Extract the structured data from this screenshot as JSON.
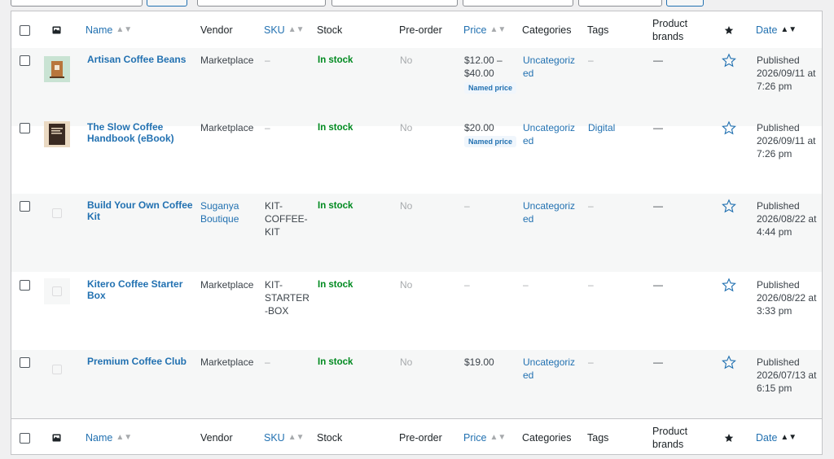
{
  "columns": {
    "name": "Name",
    "vendor": "Vendor",
    "sku": "SKU",
    "stock": "Stock",
    "preorder": "Pre-order",
    "price": "Price",
    "categories": "Categories",
    "tags": "Tags",
    "product_brands_line1": "Product",
    "product_brands_line2": "brands",
    "date": "Date"
  },
  "icons": {
    "sort": "sort-icon",
    "image": "image-icon",
    "featured": "star-icon"
  },
  "colors": {
    "link": "#2271b1",
    "in_stock": "#008a20",
    "muted": "#a7aaad",
    "alt_row": "#f6f7f7"
  },
  "rows": [
    {
      "name_line1": "Artisan Coffee Beans",
      "name_line2": "",
      "vendor_line1": "Marketplace",
      "vendor_line2": "",
      "sku_line1": "–",
      "sku_line2": "",
      "sku_line3": "",
      "stock": "In stock",
      "preorder": "No",
      "price_line1": "$12.00 –",
      "price_line2": "$40.00",
      "price_badge": "Named price",
      "cat_line1": "Uncategoriz",
      "cat_line2": "ed",
      "tags": "–",
      "brands": "—",
      "date_line1": "Published",
      "date_line2": "2026/09/11 at",
      "date_line3": "7:26 pm"
    },
    {
      "name_line1": "The Slow Coffee",
      "name_line2": "Handbook (eBook)",
      "vendor_line1": "Marketplace",
      "vendor_line2": "",
      "sku_line1": "–",
      "sku_line2": "",
      "sku_line3": "",
      "stock": "In stock",
      "preorder": "No",
      "price_line1": "$20.00",
      "price_line2": "",
      "price_badge": "Named price",
      "cat_line1": "Uncategoriz",
      "cat_line2": "ed",
      "tags": "Digital",
      "brands": "—",
      "date_line1": "Published",
      "date_line2": "2026/09/11 at",
      "date_line3": "7:26 pm"
    },
    {
      "name_line1": "Build Your Own Coffee",
      "name_line2": "Kit",
      "vendor_line1": "Suganya",
      "vendor_line2": "Boutique",
      "sku_line1": "KIT-",
      "sku_line2": "COFFEE-",
      "sku_line3": "KIT",
      "stock": "In stock",
      "preorder": "No",
      "price_line1": "–",
      "price_line2": "",
      "price_badge": "",
      "cat_line1": "Uncategoriz",
      "cat_line2": "ed",
      "tags": "–",
      "brands": "—",
      "date_line1": "Published",
      "date_line2": "2026/08/22 at",
      "date_line3": "4:44 pm"
    },
    {
      "name_line1": "Kitero Coffee Starter",
      "name_line2": "Box",
      "vendor_line1": "Marketplace",
      "vendor_line2": "",
      "sku_line1": "KIT-",
      "sku_line2": "STARTER",
      "sku_line3": "-BOX",
      "stock": "In stock",
      "preorder": "No",
      "price_line1": "–",
      "price_line2": "",
      "price_badge": "",
      "cat_line1": "–",
      "cat_line2": "",
      "tags": "–",
      "brands": "—",
      "date_line1": "Published",
      "date_line2": "2026/08/22 at",
      "date_line3": "3:33 pm"
    },
    {
      "name_line1": "Premium Coffee Club",
      "name_line2": "",
      "vendor_line1": "Marketplace",
      "vendor_line2": "",
      "sku_line1": "–",
      "sku_line2": "",
      "sku_line3": "",
      "stock": "In stock",
      "preorder": "No",
      "price_line1": "$19.00",
      "price_line2": "",
      "price_badge": "",
      "cat_line1": "Uncategoriz",
      "cat_line2": "ed",
      "tags": "–",
      "brands": "—",
      "date_line1": "Published",
      "date_line2": "2026/07/13 at",
      "date_line3": "6:15 pm"
    }
  ]
}
